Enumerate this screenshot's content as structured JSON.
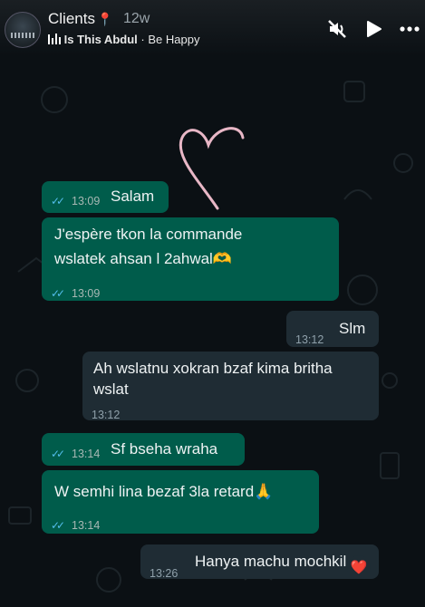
{
  "header": {
    "title": "Clients",
    "age": "12w",
    "artist": "Is This Abdul",
    "song": "Be Happy",
    "separator": "·",
    "icons": [
      "avatar",
      "pin-icon",
      "equalizer-icon",
      "mute-icon",
      "play-icon",
      "more-icon"
    ]
  },
  "messages": [
    {
      "text": "Salam",
      "time": "13:09"
    },
    {
      "line1": "J'espère tkon la commande",
      "line2": "wslatek ahsan l 2ahwal🫶",
      "time": "13:09"
    },
    {
      "text": "Slm",
      "time": "13:12"
    },
    {
      "line1": "Ah wslatnu xokran bzaf kima britha",
      "line2": "wslat",
      "time": "13:12"
    },
    {
      "text": "Sf bseha wraha",
      "time": "13:14"
    },
    {
      "text": "W semhi lina bezaf 3la retard🙏",
      "time": "13:14"
    },
    {
      "text": "Hanya machu mochkil",
      "time": "13:26"
    }
  ],
  "reaction": "❤️",
  "colors": {
    "incoming": "#005c4b",
    "outgoing": "#1f2c34",
    "ticks": "#53bdeb",
    "background": "#0b1014"
  }
}
